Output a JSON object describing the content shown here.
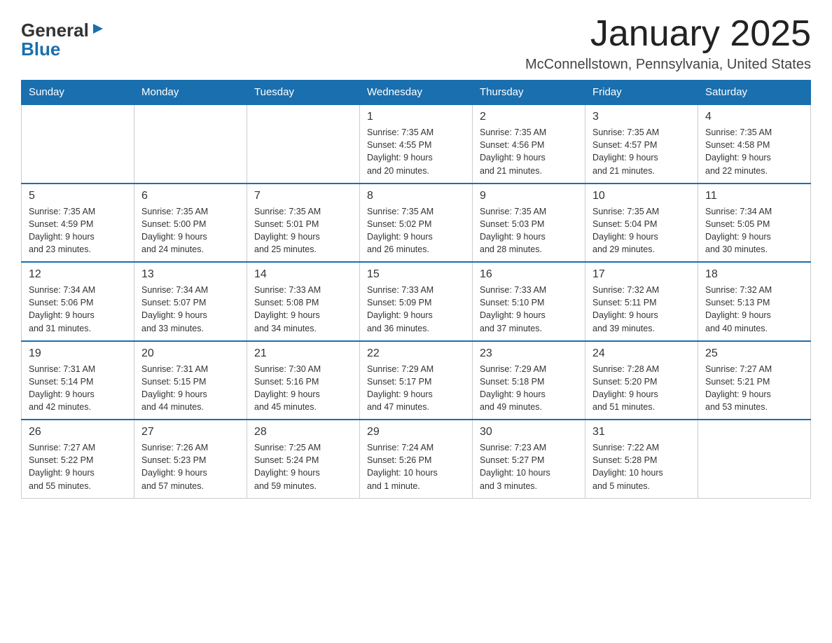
{
  "logo": {
    "part1": "General",
    "arrow": "▶",
    "part2": "Blue"
  },
  "title": "January 2025",
  "location": "McConnellstown, Pennsylvania, United States",
  "weekdays": [
    "Sunday",
    "Monday",
    "Tuesday",
    "Wednesday",
    "Thursday",
    "Friday",
    "Saturday"
  ],
  "weeks": [
    [
      {
        "day": "",
        "info": ""
      },
      {
        "day": "",
        "info": ""
      },
      {
        "day": "",
        "info": ""
      },
      {
        "day": "1",
        "info": "Sunrise: 7:35 AM\nSunset: 4:55 PM\nDaylight: 9 hours\nand 20 minutes."
      },
      {
        "day": "2",
        "info": "Sunrise: 7:35 AM\nSunset: 4:56 PM\nDaylight: 9 hours\nand 21 minutes."
      },
      {
        "day": "3",
        "info": "Sunrise: 7:35 AM\nSunset: 4:57 PM\nDaylight: 9 hours\nand 21 minutes."
      },
      {
        "day": "4",
        "info": "Sunrise: 7:35 AM\nSunset: 4:58 PM\nDaylight: 9 hours\nand 22 minutes."
      }
    ],
    [
      {
        "day": "5",
        "info": "Sunrise: 7:35 AM\nSunset: 4:59 PM\nDaylight: 9 hours\nand 23 minutes."
      },
      {
        "day": "6",
        "info": "Sunrise: 7:35 AM\nSunset: 5:00 PM\nDaylight: 9 hours\nand 24 minutes."
      },
      {
        "day": "7",
        "info": "Sunrise: 7:35 AM\nSunset: 5:01 PM\nDaylight: 9 hours\nand 25 minutes."
      },
      {
        "day": "8",
        "info": "Sunrise: 7:35 AM\nSunset: 5:02 PM\nDaylight: 9 hours\nand 26 minutes."
      },
      {
        "day": "9",
        "info": "Sunrise: 7:35 AM\nSunset: 5:03 PM\nDaylight: 9 hours\nand 28 minutes."
      },
      {
        "day": "10",
        "info": "Sunrise: 7:35 AM\nSunset: 5:04 PM\nDaylight: 9 hours\nand 29 minutes."
      },
      {
        "day": "11",
        "info": "Sunrise: 7:34 AM\nSunset: 5:05 PM\nDaylight: 9 hours\nand 30 minutes."
      }
    ],
    [
      {
        "day": "12",
        "info": "Sunrise: 7:34 AM\nSunset: 5:06 PM\nDaylight: 9 hours\nand 31 minutes."
      },
      {
        "day": "13",
        "info": "Sunrise: 7:34 AM\nSunset: 5:07 PM\nDaylight: 9 hours\nand 33 minutes."
      },
      {
        "day": "14",
        "info": "Sunrise: 7:33 AM\nSunset: 5:08 PM\nDaylight: 9 hours\nand 34 minutes."
      },
      {
        "day": "15",
        "info": "Sunrise: 7:33 AM\nSunset: 5:09 PM\nDaylight: 9 hours\nand 36 minutes."
      },
      {
        "day": "16",
        "info": "Sunrise: 7:33 AM\nSunset: 5:10 PM\nDaylight: 9 hours\nand 37 minutes."
      },
      {
        "day": "17",
        "info": "Sunrise: 7:32 AM\nSunset: 5:11 PM\nDaylight: 9 hours\nand 39 minutes."
      },
      {
        "day": "18",
        "info": "Sunrise: 7:32 AM\nSunset: 5:13 PM\nDaylight: 9 hours\nand 40 minutes."
      }
    ],
    [
      {
        "day": "19",
        "info": "Sunrise: 7:31 AM\nSunset: 5:14 PM\nDaylight: 9 hours\nand 42 minutes."
      },
      {
        "day": "20",
        "info": "Sunrise: 7:31 AM\nSunset: 5:15 PM\nDaylight: 9 hours\nand 44 minutes."
      },
      {
        "day": "21",
        "info": "Sunrise: 7:30 AM\nSunset: 5:16 PM\nDaylight: 9 hours\nand 45 minutes."
      },
      {
        "day": "22",
        "info": "Sunrise: 7:29 AM\nSunset: 5:17 PM\nDaylight: 9 hours\nand 47 minutes."
      },
      {
        "day": "23",
        "info": "Sunrise: 7:29 AM\nSunset: 5:18 PM\nDaylight: 9 hours\nand 49 minutes."
      },
      {
        "day": "24",
        "info": "Sunrise: 7:28 AM\nSunset: 5:20 PM\nDaylight: 9 hours\nand 51 minutes."
      },
      {
        "day": "25",
        "info": "Sunrise: 7:27 AM\nSunset: 5:21 PM\nDaylight: 9 hours\nand 53 minutes."
      }
    ],
    [
      {
        "day": "26",
        "info": "Sunrise: 7:27 AM\nSunset: 5:22 PM\nDaylight: 9 hours\nand 55 minutes."
      },
      {
        "day": "27",
        "info": "Sunrise: 7:26 AM\nSunset: 5:23 PM\nDaylight: 9 hours\nand 57 minutes."
      },
      {
        "day": "28",
        "info": "Sunrise: 7:25 AM\nSunset: 5:24 PM\nDaylight: 9 hours\nand 59 minutes."
      },
      {
        "day": "29",
        "info": "Sunrise: 7:24 AM\nSunset: 5:26 PM\nDaylight: 10 hours\nand 1 minute."
      },
      {
        "day": "30",
        "info": "Sunrise: 7:23 AM\nSunset: 5:27 PM\nDaylight: 10 hours\nand 3 minutes."
      },
      {
        "day": "31",
        "info": "Sunrise: 7:22 AM\nSunset: 5:28 PM\nDaylight: 10 hours\nand 5 minutes."
      },
      {
        "day": "",
        "info": ""
      }
    ]
  ]
}
